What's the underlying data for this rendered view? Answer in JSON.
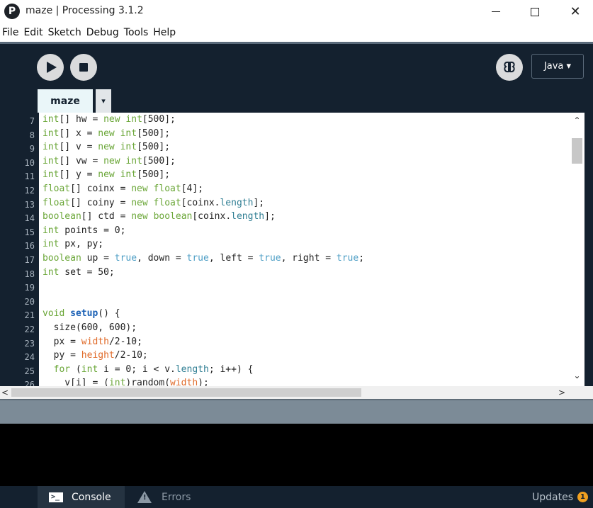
{
  "window": {
    "title": "maze | Processing 3.1.2",
    "logo": "P",
    "minimize": "",
    "maximize": "",
    "close": "✕"
  },
  "menu": [
    "File",
    "Edit",
    "Sketch",
    "Debug",
    "Tools",
    "Help"
  ],
  "toolbar": {
    "mode_label": "Java ▾"
  },
  "tabs": {
    "active": "maze",
    "menu_arrow": "▾"
  },
  "editor": {
    "line_numbers": [
      "7",
      "8",
      "9",
      "10",
      "11",
      "12",
      "13",
      "14",
      "15",
      "16",
      "17",
      "18",
      "19",
      "20",
      "21",
      "22",
      "23",
      "24",
      "25",
      "26"
    ],
    "lines": [
      [
        {
          "t": "int",
          "c": "kw"
        },
        {
          "t": "[] hw = ",
          "c": ""
        },
        {
          "t": "new",
          "c": "kw"
        },
        {
          "t": " ",
          "c": ""
        },
        {
          "t": "int",
          "c": "kw"
        },
        {
          "t": "[500];",
          "c": ""
        }
      ],
      [
        {
          "t": "int",
          "c": "kw"
        },
        {
          "t": "[] x = ",
          "c": ""
        },
        {
          "t": "new",
          "c": "kw"
        },
        {
          "t": " ",
          "c": ""
        },
        {
          "t": "int",
          "c": "kw"
        },
        {
          "t": "[500];",
          "c": ""
        }
      ],
      [
        {
          "t": "int",
          "c": "kw"
        },
        {
          "t": "[] v = ",
          "c": ""
        },
        {
          "t": "new",
          "c": "kw"
        },
        {
          "t": " ",
          "c": ""
        },
        {
          "t": "int",
          "c": "kw"
        },
        {
          "t": "[500];",
          "c": ""
        }
      ],
      [
        {
          "t": "int",
          "c": "kw"
        },
        {
          "t": "[] vw = ",
          "c": ""
        },
        {
          "t": "new",
          "c": "kw"
        },
        {
          "t": " ",
          "c": ""
        },
        {
          "t": "int",
          "c": "kw"
        },
        {
          "t": "[500];",
          "c": ""
        }
      ],
      [
        {
          "t": "int",
          "c": "kw"
        },
        {
          "t": "[] y = ",
          "c": ""
        },
        {
          "t": "new",
          "c": "kw"
        },
        {
          "t": " ",
          "c": ""
        },
        {
          "t": "int",
          "c": "kw"
        },
        {
          "t": "[500];",
          "c": ""
        }
      ],
      [
        {
          "t": "float",
          "c": "kw"
        },
        {
          "t": "[] coinx = ",
          "c": ""
        },
        {
          "t": "new",
          "c": "kw"
        },
        {
          "t": " ",
          "c": ""
        },
        {
          "t": "float",
          "c": "kw"
        },
        {
          "t": "[4];",
          "c": ""
        }
      ],
      [
        {
          "t": "float",
          "c": "kw"
        },
        {
          "t": "[] coiny = ",
          "c": ""
        },
        {
          "t": "new",
          "c": "kw"
        },
        {
          "t": " ",
          "c": ""
        },
        {
          "t": "float",
          "c": "kw"
        },
        {
          "t": "[coinx.",
          "c": ""
        },
        {
          "t": "length",
          "c": "prop"
        },
        {
          "t": "];",
          "c": ""
        }
      ],
      [
        {
          "t": "boolean",
          "c": "kw"
        },
        {
          "t": "[] ctd = ",
          "c": ""
        },
        {
          "t": "new",
          "c": "kw"
        },
        {
          "t": " ",
          "c": ""
        },
        {
          "t": "boolean",
          "c": "kw"
        },
        {
          "t": "[coinx.",
          "c": ""
        },
        {
          "t": "length",
          "c": "prop"
        },
        {
          "t": "];",
          "c": ""
        }
      ],
      [
        {
          "t": "int",
          "c": "kw"
        },
        {
          "t": " points = 0;",
          "c": ""
        }
      ],
      [
        {
          "t": "int",
          "c": "kw"
        },
        {
          "t": " px, py;",
          "c": ""
        }
      ],
      [
        {
          "t": "boolean",
          "c": "kw"
        },
        {
          "t": " up = ",
          "c": ""
        },
        {
          "t": "true",
          "c": "const"
        },
        {
          "t": ", down = ",
          "c": ""
        },
        {
          "t": "true",
          "c": "const"
        },
        {
          "t": ", left = ",
          "c": ""
        },
        {
          "t": "true",
          "c": "const"
        },
        {
          "t": ", right = ",
          "c": ""
        },
        {
          "t": "true",
          "c": "const"
        },
        {
          "t": ";",
          "c": ""
        }
      ],
      [
        {
          "t": "int",
          "c": "kw"
        },
        {
          "t": " set = 50;",
          "c": ""
        }
      ],
      [
        {
          "t": "",
          "c": ""
        }
      ],
      [
        {
          "t": "",
          "c": ""
        }
      ],
      [
        {
          "t": "void",
          "c": "kw"
        },
        {
          "t": " ",
          "c": ""
        },
        {
          "t": "setup",
          "c": "fn"
        },
        {
          "t": "() {",
          "c": ""
        }
      ],
      [
        {
          "t": "  size(600, 600);",
          "c": ""
        }
      ],
      [
        {
          "t": "  px = ",
          "c": ""
        },
        {
          "t": "width",
          "c": "vb"
        },
        {
          "t": "/2-10;",
          "c": ""
        }
      ],
      [
        {
          "t": "  py = ",
          "c": ""
        },
        {
          "t": "height",
          "c": "vb"
        },
        {
          "t": "/2-10;",
          "c": ""
        }
      ],
      [
        {
          "t": "  ",
          "c": ""
        },
        {
          "t": "for",
          "c": "kw"
        },
        {
          "t": " (",
          "c": ""
        },
        {
          "t": "int",
          "c": "kw"
        },
        {
          "t": " i = 0; i < v.",
          "c": ""
        },
        {
          "t": "length",
          "c": "prop"
        },
        {
          "t": "; i++) {",
          "c": ""
        }
      ],
      [
        {
          "t": "    v[i] = (",
          "c": ""
        },
        {
          "t": "int",
          "c": "kw"
        },
        {
          "t": ")random(",
          "c": ""
        },
        {
          "t": "width",
          "c": "vb"
        },
        {
          "t": ");",
          "c": ""
        }
      ]
    ]
  },
  "scroll": {
    "up": "⌃",
    "down": "⌄",
    "left": "<",
    "right": ">"
  },
  "footer": {
    "console_label": "Console",
    "errors_label": "Errors",
    "updates_label": "Updates",
    "updates_count": "1",
    "console_icon": ">_",
    "errors_icon": "!"
  }
}
